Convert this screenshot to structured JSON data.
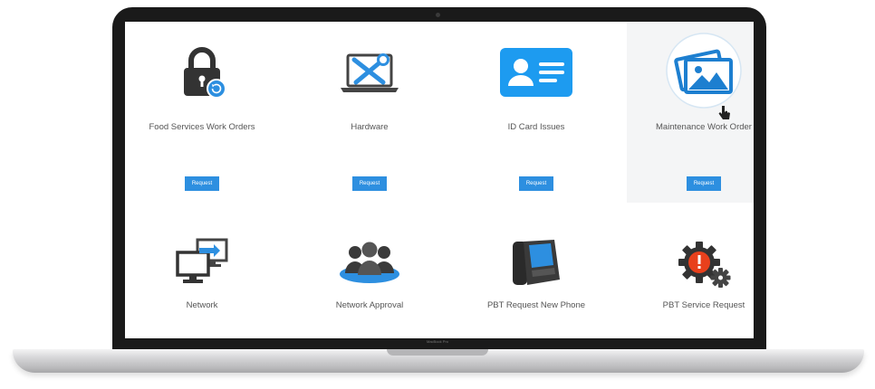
{
  "laptop": {
    "brand": "MacBook Pro"
  },
  "tiles": [
    {
      "label": "Food Services Work Orders",
      "button": "Request",
      "icon": "lock-refresh-icon"
    },
    {
      "label": "Hardware",
      "button": "Request",
      "icon": "laptop-tools-icon"
    },
    {
      "label": "ID Card Issues",
      "button": "Request",
      "icon": "id-card-icon"
    },
    {
      "label": "Maintenance Work Order",
      "button": "Request",
      "icon": "images-icon",
      "highlighted": true
    },
    {
      "label": "Network",
      "icon": "network-monitors-icon"
    },
    {
      "label": "Network Approval",
      "icon": "people-group-icon"
    },
    {
      "label": "PBT Request New Phone",
      "icon": "desk-phone-icon"
    },
    {
      "label": "PBT Service Request",
      "icon": "gear-alert-icon"
    }
  ],
  "colors": {
    "accent": "#2d8fe0",
    "icon_dark": "#333333",
    "alert": "#e8401c"
  }
}
